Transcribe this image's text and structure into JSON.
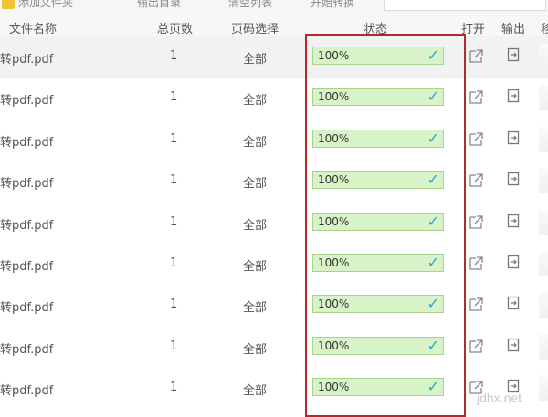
{
  "toolbar": {
    "items": [
      "添加文件夹",
      "输出目录",
      "清空列表",
      "开始转换"
    ]
  },
  "header": {
    "filename": "文件名称",
    "pages": "总页数",
    "range": "页码选择",
    "status": "状态",
    "open": "打开",
    "export": "输出",
    "extra": "移"
  },
  "rows": [
    {
      "name": "转pdf.pdf",
      "pages": "1",
      "range": "全部",
      "progress": "100%"
    },
    {
      "name": "转pdf.pdf",
      "pages": "1",
      "range": "全部",
      "progress": "100%"
    },
    {
      "name": "转pdf.pdf",
      "pages": "1",
      "range": "全部",
      "progress": "100%"
    },
    {
      "name": "转pdf.pdf",
      "pages": "1",
      "range": "全部",
      "progress": "100%"
    },
    {
      "name": "转pdf.pdf",
      "pages": "1",
      "range": "全部",
      "progress": "100%"
    },
    {
      "name": "转pdf.pdf",
      "pages": "1",
      "range": "全部",
      "progress": "100%"
    },
    {
      "name": "转pdf.pdf",
      "pages": "1",
      "range": "全部",
      "progress": "100%"
    },
    {
      "name": "转pdf.pdf",
      "pages": "1",
      "range": "全部",
      "progress": "100%"
    },
    {
      "name": "转pdf.pdf",
      "pages": "1",
      "range": "全部",
      "progress": "100%"
    }
  ],
  "icons": {
    "status_done": "checkmark-icon",
    "open": "open-external-icon",
    "export": "export-file-icon"
  },
  "colors": {
    "status_fill": "#d9f3c8",
    "status_border": "#a9d38c",
    "check": "#29a8c9",
    "highlight": "#b22a2a"
  },
  "watermark": "jdhx.net"
}
